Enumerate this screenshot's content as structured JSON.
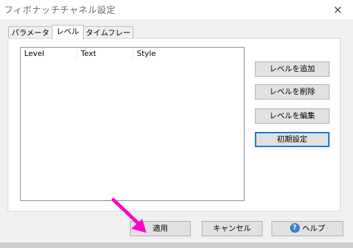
{
  "window": {
    "title": "フィボナッチチャネル設定",
    "close_glyph": "✕"
  },
  "tabs": [
    {
      "label": "パラメーター",
      "active": false
    },
    {
      "label": "レベル",
      "active": true
    },
    {
      "label": "タイムフレーム",
      "active": false
    }
  ],
  "levels_list": {
    "columns": [
      "Level",
      "Text",
      "Style"
    ],
    "rows": []
  },
  "side_buttons": {
    "add": "レベルを追加",
    "delete": "レベルを削除",
    "edit": "レベルを編集",
    "reset": "初期設定"
  },
  "footer_buttons": {
    "apply": "適用",
    "cancel": "キャンセル",
    "help": "ヘルプ"
  },
  "icons": {
    "help": "question-circle-icon",
    "close": "close-icon",
    "annotation": "pointer-arrow-icon"
  },
  "colors": {
    "accent": "#0078d7",
    "arrow": "#ff00cc",
    "help_icon": "#3a7fd0"
  }
}
